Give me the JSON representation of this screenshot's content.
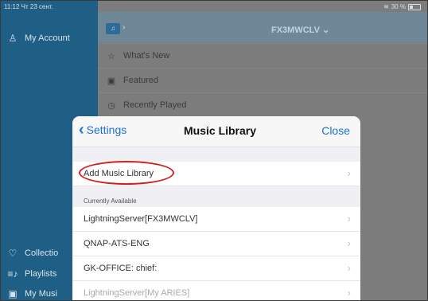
{
  "status_bar": {
    "time_date": "11:12  Чт 23 сент.",
    "battery": "30 %"
  },
  "sidebar": {
    "items": [
      {
        "label": "My Account",
        "icon": "person-icon"
      },
      {
        "label": "Collectio",
        "icon": "heart-icon"
      },
      {
        "label": "Playlists",
        "icon": "playlist-icon"
      },
      {
        "label": "My Musi",
        "icon": "music-icon"
      }
    ]
  },
  "main": {
    "header_title": "FX3MWCLV",
    "header_chevron": "⌄",
    "menu": [
      {
        "label": "What's New",
        "icon": "star-icon"
      },
      {
        "label": "Featured",
        "icon": "featured-icon"
      },
      {
        "label": "Recently Played",
        "icon": "clock-icon"
      }
    ]
  },
  "modal": {
    "back_label": "Settings",
    "title": "Music Library",
    "close_label": "Close",
    "add_library_label": "Add Music Library",
    "section_header": "Currently Available",
    "libraries": [
      "LightningServer[FX3MWCLV]",
      "QNAP-ATS-ENG",
      "GK-OFFICE: chief:",
      "LightningServer[My ARIES]"
    ]
  },
  "colors": {
    "sidebar": "#1f5f86",
    "accent": "#1a73d9",
    "highlight": "#d11e1e"
  }
}
